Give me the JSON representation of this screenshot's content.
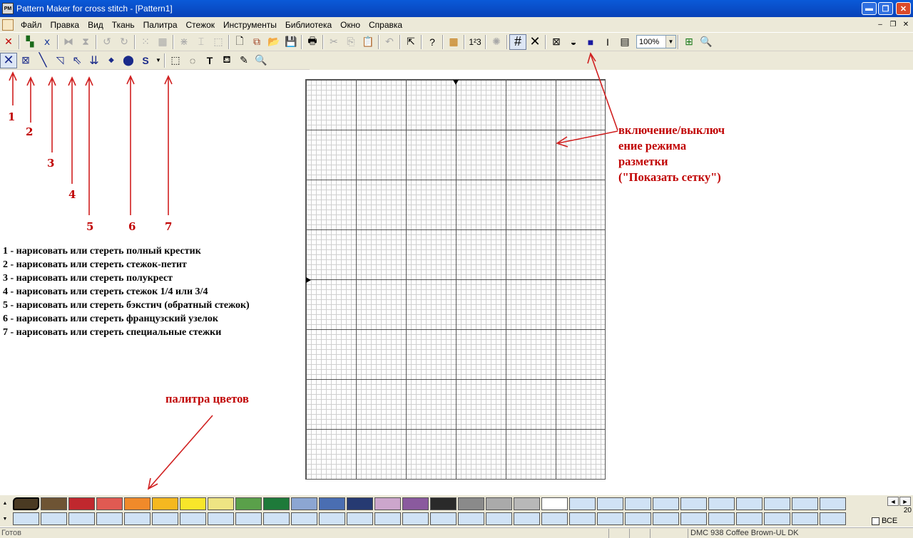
{
  "window": {
    "title": "Pattern Maker for cross stitch - [Pattern1]",
    "app_icon_text": "PM",
    "minimize": "▬",
    "maximize": "❐",
    "close": "✕"
  },
  "menu": {
    "items": [
      "Файл",
      "Правка",
      "Вид",
      "Ткань",
      "Палитра",
      "Стежок",
      "Инструменты",
      "Библиотека",
      "Окно",
      "Справка"
    ],
    "mdi": [
      "–",
      "❐",
      "✕"
    ]
  },
  "toolbar1": {
    "zoom": "100%"
  },
  "annotations": {
    "numbers": [
      "1",
      "2",
      "3",
      "4",
      "5",
      "6",
      "7"
    ],
    "legend": [
      "1 - нарисовать или стереть полный крестик",
      "2 - нарисовать или стереть стежок-петит",
      "3 - нарисовать или стереть полукрест",
      "4 - нарисовать или стереть стежок 1/4 или 3/4",
      "5 - нарисовать или стереть бэкстич (обратный стежок)",
      "6 - нарисовать или стереть французский узелок",
      "7 - нарисовать или стереть специальные стежки"
    ],
    "grid_note": [
      "включение/выключ",
      "ение режима",
      "разметки",
      "(\"Показать сетку\")"
    ],
    "palette_note": "палитра цветов",
    "arrow_color": "#d02020"
  },
  "palette": {
    "row1": [
      "#4a3a22",
      "#6e5434",
      "#c0282e",
      "#e05a52",
      "#f08a2a",
      "#f5b820",
      "#f8e62a",
      "#eee483",
      "#5aa04a",
      "#1e7a3a",
      "#8ca6d2",
      "#4a6eb2",
      "#263a72",
      "#cca6cc",
      "#8a5a9e",
      "#2a2a2a",
      "#8a8a8a",
      "#aaaaaa",
      "#b8b8b8",
      "#ffffff",
      "#d0e2f5",
      "#d0e2f5",
      "#d0e2f5",
      "#d0e2f5",
      "#d0e2f5",
      "#d0e2f5",
      "#d0e2f5",
      "#d0e2f5",
      "#d0e2f5",
      "#d0e2f5"
    ],
    "row2_count": 30,
    "empty_color": "#d0e2f5",
    "count": "20",
    "all_label": "ВСЕ",
    "nav_left": "◄",
    "nav_right": "►",
    "scroll_up": "▲",
    "scroll_down": "▼"
  },
  "status": {
    "left": "Готов",
    "thread": "DMC  938  Coffee Brown-UL DK"
  }
}
